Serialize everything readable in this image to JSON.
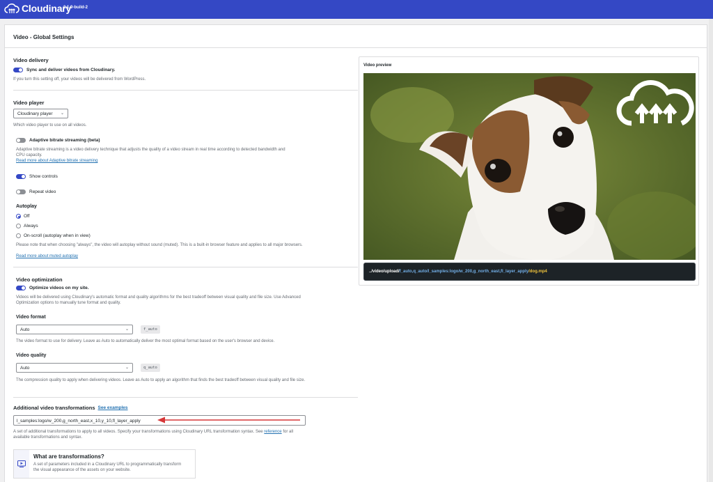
{
  "header": {
    "brand": "Cloudinary",
    "version": "3.1.9-build-2"
  },
  "page": {
    "title": "Video - Global Settings"
  },
  "delivery": {
    "title": "Video delivery",
    "toggle_label": "Sync and deliver videos from Cloudinary.",
    "toggle_state": "on",
    "description": "If you turn this setting off, your videos will be delivered from WordPress."
  },
  "player": {
    "title": "Video player",
    "selected": "Cloudinary player",
    "description": "Which video player to use on all videos.",
    "abr": {
      "label": "Adaptive bitrate streaming (beta)",
      "state": "off",
      "description": "Adaptive bitrate streaming is a video delivery technique that adjusts the quality of a video stream in real time according to detected bandwidth and CPU capacity.",
      "link": "Read more about Adaptive bitrate streaming"
    },
    "controls": {
      "label": "Show controls",
      "state": "on"
    },
    "repeat": {
      "label": "Repeat video",
      "state": "off"
    },
    "autoplay": {
      "title": "Autoplay",
      "options": [
        "Off",
        "Always",
        "On-scroll (autoplay when in view)"
      ],
      "selected": "Off",
      "note": "Please note that when choosing \"always\", the video will autoplay without sound (muted). This is a built-in browser feature and applies to all major browsers.",
      "link": "Read more about muted autoplay"
    }
  },
  "optimization": {
    "title": "Video optimization",
    "toggle_label": "Optimize videos on my site.",
    "toggle_state": "on",
    "description": "Videos will be delivered using Cloudinary's automatic format and quality algorithms for the best tradeoff between visual quality and file size. Use Advanced Optimization options to manually tune format and quality.",
    "format": {
      "title": "Video format",
      "selected": "Auto",
      "badge": "f_auto",
      "description": "The video format to use for delivery. Leave as Auto to automatically deliver the most optimal format based on the user's browser and device."
    },
    "quality": {
      "title": "Video quality",
      "selected": "Auto",
      "badge": "q_auto",
      "description": "The compression quality to apply when delivering videos. Leave as Auto to apply an algorithm that finds the best tradeoff between visual quality and file size."
    }
  },
  "transformations": {
    "title": "Additional video transformations",
    "examples_link": "See examples",
    "value": "l_samples:logo/w_200,g_north_east,x_10,y_10,fl_layer_apply",
    "description_pre": "A set of additional transformations to apply to all videos. Specify your transformations using Cloudinary URL transformation syntax. See",
    "description_link": "reference",
    "description_post": "for all available transformations and syntax.",
    "card_title": "What are transformations?",
    "card_text": "A set of parameters included in a Cloudinary URL to programmatically transform the visual appearance of the assets on your website."
  },
  "preview": {
    "title": "Video preview",
    "url_prefix": "../video/upload/",
    "url_transform": "f_auto,q_auto/l_samples:logo/w_200,g_north_east,fl_layer_apply",
    "url_file": "/dog.mp4"
  },
  "colors": {
    "brand": "#3448c5",
    "arrow": "#d63638"
  }
}
